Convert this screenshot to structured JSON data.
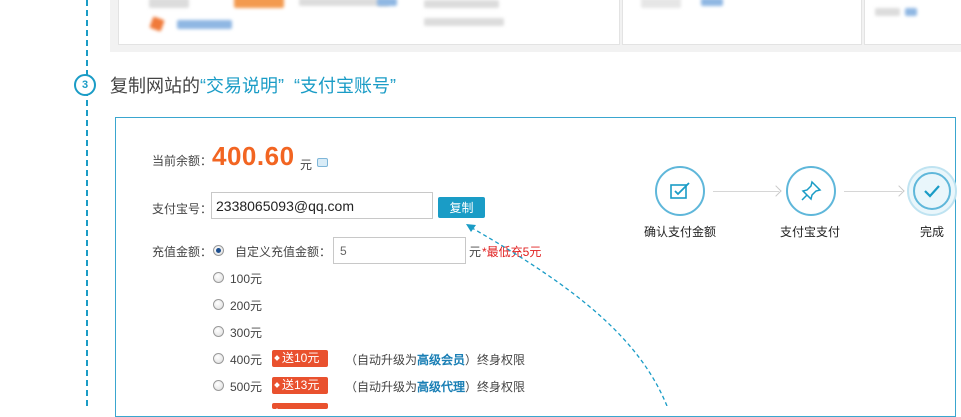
{
  "step": {
    "number": "3",
    "title_prefix": "复制网站的",
    "highlight_1": "“交易说明”",
    "highlight_2": "“支付宝账号”"
  },
  "form": {
    "balance_label": "当前余额：",
    "balance_value": "400.60",
    "balance_unit": "元",
    "alipay_label": "支付宝号：",
    "alipay_account": "2338065093@qq.com",
    "copy_button": "复制",
    "amount_label": "充值金额：",
    "custom_option_label": "自定义充值金额：",
    "custom_amount": "5",
    "custom_unit": "元",
    "min_note": "*最低充5元",
    "options": [
      {
        "label": "100元",
        "badge": "",
        "upgrade_prefix": "",
        "upgrade_level": "",
        "upgrade_suffix": ""
      },
      {
        "label": "200元",
        "badge": "",
        "upgrade_prefix": "",
        "upgrade_level": "",
        "upgrade_suffix": ""
      },
      {
        "label": "300元",
        "badge": "",
        "upgrade_prefix": "",
        "upgrade_level": "",
        "upgrade_suffix": ""
      },
      {
        "label": "400元",
        "badge": "送10元",
        "upgrade_prefix": "（自动升级为",
        "upgrade_level": "高级会员",
        "upgrade_suffix": "）终身权限"
      },
      {
        "label": "500元",
        "badge": "送13元",
        "upgrade_prefix": "（自动升级为",
        "upgrade_level": "高级代理",
        "upgrade_suffix": "）终身权限"
      }
    ]
  },
  "flow": {
    "steps": [
      {
        "label": "确认支付金额",
        "icon": "check-doc-icon"
      },
      {
        "label": "支付宝支付",
        "icon": "pin-icon"
      },
      {
        "label": "完成",
        "icon": "check-icon"
      }
    ]
  },
  "colors": {
    "accent": "#1a9cc6",
    "balance": "#f26522",
    "badge": "#e9512e",
    "warning": "#e02020"
  }
}
